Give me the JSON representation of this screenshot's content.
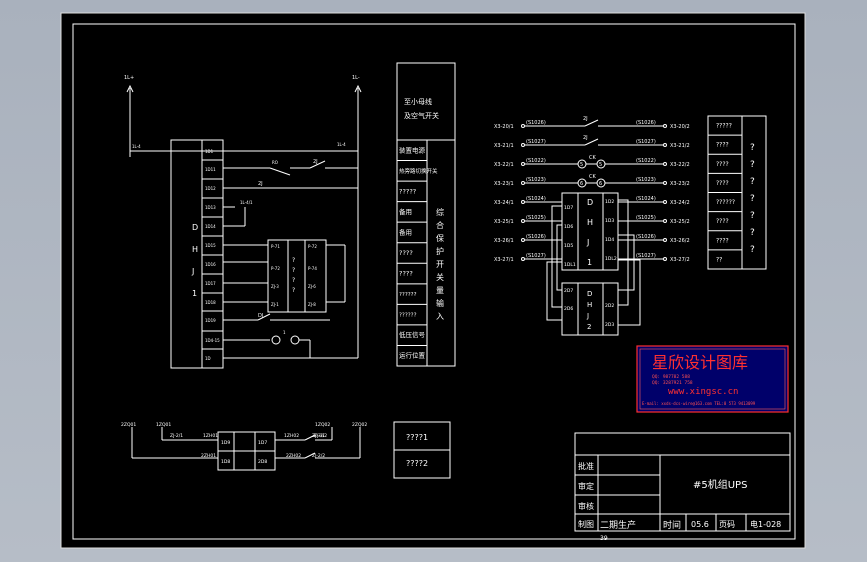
{
  "bus_labels": {
    "positive": "1L+",
    "negative": "1L-",
    "tap": "1L-4"
  },
  "dhj_block": {
    "terminals": [
      "1D1",
      "1D11",
      "1D12",
      "1D13",
      "1D14",
      "1D15",
      "1D16",
      "1D17",
      "1D18",
      "1D19",
      "1D4-15",
      "1D"
    ],
    "letters": [
      "D",
      "H",
      "J",
      "1"
    ]
  },
  "relay_labels": {
    "ra": "RO",
    "zj1": "2J",
    "zj2": "2J",
    "node": "1L-4/1"
  },
  "interface_block": {
    "left": [
      "P-71",
      "P-72",
      "ZJ-3",
      "ZJ-1"
    ],
    "right": [
      "P-72",
      "P-74",
      "ZJ-6",
      "ZJ-8"
    ],
    "q": [
      "?",
      "?",
      "?",
      "?"
    ]
  },
  "aux_labels": {
    "dj": "DJ",
    "rs": "1"
  },
  "terminal_column": {
    "header": "至小母线\n及空气开关",
    "rows": [
      "装置电源",
      "热旁路切换开关",
      "?????",
      "备用",
      "备用",
      "????",
      "????",
      "??????",
      "??????",
      "低压信号",
      "运行位置"
    ],
    "side": "综合保护开关量输入"
  },
  "right_bus": {
    "left_terms": [
      "X3-20/1",
      "X3-21/1",
      "X3-22/1",
      "X3-23/1",
      "X3-24/1",
      "X3-25/1",
      "X3-26/1",
      "X3-27/1"
    ],
    "left_wires": [
      "(S1026)",
      "(S1027)",
      "(S1022)",
      "(S1023)",
      "(S1024)",
      "(S1025)",
      "(S1026)",
      "(S1027)"
    ],
    "right_wires": [
      "(S1026)",
      "(S1027)",
      "(S1022)",
      "(S1023)",
      "(S1024)",
      "(S1025)",
      "(S1026)",
      "(S1027)"
    ],
    "right_terms": [
      "X3-20/2",
      "X3-21/2",
      "X3-22/2",
      "X3-23/2",
      "X3-24/2",
      "X3-25/2",
      "X3-26/2",
      "X3-27/2"
    ],
    "switch_labels": [
      "2J",
      "2J",
      "CK",
      "CK"
    ],
    "lamp_labels": [
      "5",
      "6",
      "5",
      "6"
    ]
  },
  "dhj1_block": {
    "letters": [
      "D",
      "H",
      "J",
      "1"
    ],
    "left": [
      "1D7",
      "1D6",
      "1D5",
      "1DL1"
    ],
    "right": [
      "1D2",
      "1D3",
      "1D4",
      "1DL2"
    ]
  },
  "dhj2_block": {
    "letters": [
      "D",
      "H",
      "J",
      "2"
    ],
    "left": [
      "2D7",
      "2D6"
    ],
    "right": [
      "2D2",
      "2D3"
    ]
  },
  "right_list": {
    "items": [
      "?????",
      "????",
      "????",
      "????",
      "??????",
      "????",
      "????",
      "??"
    ],
    "q": [
      "?",
      "?",
      "?",
      "?",
      "?",
      "?",
      "?"
    ]
  },
  "watermark": {
    "title": "星欣设计图库",
    "line1": "QQ: 987782 588",
    "line2": "QQ: 3287921 758",
    "url": "www.xingsc.cn",
    "contact": "E-mail: xxds-dcs-wire@163.com  TEL:0 573 9413099"
  },
  "bottom_circuit": {
    "labels": [
      "2ZQ01",
      "1ZQ01",
      "1ZQ02",
      "2ZQ02",
      "ZJ-2/1",
      "ZJ-3/1",
      "1ZH01",
      "2ZH01",
      "1ZH02",
      "2ZH02",
      "ZJ-3/2",
      "ZJ-2/2"
    ],
    "box_left": [
      "1D9",
      "1D8"
    ],
    "box_right": [
      "1D7",
      "2D8"
    ]
  },
  "small_table": {
    "rows": [
      "????1",
      "????2"
    ]
  },
  "title_block": {
    "rows": [
      "批准",
      "审定",
      "审核",
      "制图"
    ],
    "title": "#5机组UPS",
    "phase": "二期生产",
    "time_label": "时间",
    "time_value": "05.6",
    "page_label": "页码",
    "page_value": "电1-028",
    "foot": "39"
  }
}
